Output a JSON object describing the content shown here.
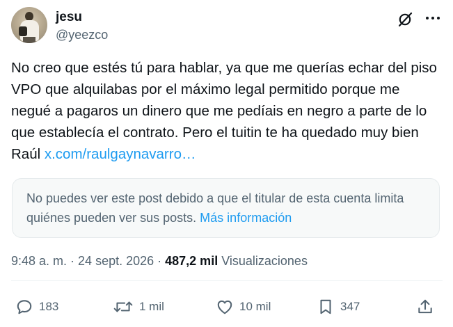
{
  "author": {
    "name": "jesu",
    "handle": "@yeezco"
  },
  "tweet": {
    "text": "No creo que estés tú para hablar, ya que me querías echar del piso VPO que alquilabas por el máximo legal permitido porque me negué a pagaros un dinero que me pedíais en negro a parte de lo que establecía el contrato. Pero el tuitin te ha quedado muy bien Raúl ",
    "link": "x.com/raulgaynavarro…"
  },
  "quoted_notice": {
    "text": "No puedes ver este post debido a que el titular de esta cuenta limita quiénes pueden ver sus posts. ",
    "link": "Más información"
  },
  "meta": {
    "time": "9:48 a. m.",
    "separator_1": " · ",
    "date": "24 sept. 2026",
    "separator_2": " · ",
    "views_count": "487,2 mil",
    "views_label": " Visualizaciones"
  },
  "actions": {
    "replies": "183",
    "reposts": "1 mil",
    "likes": "10 mil",
    "bookmarks": "347"
  },
  "icons": [
    "grok-icon",
    "more-icon",
    "reply-icon",
    "repost-icon",
    "like-icon",
    "bookmark-icon",
    "share-icon"
  ],
  "colors": {
    "text": "#0f1419",
    "secondary": "#536471",
    "link": "#1d9bf0",
    "notice_bg": "#f7f9f9"
  }
}
